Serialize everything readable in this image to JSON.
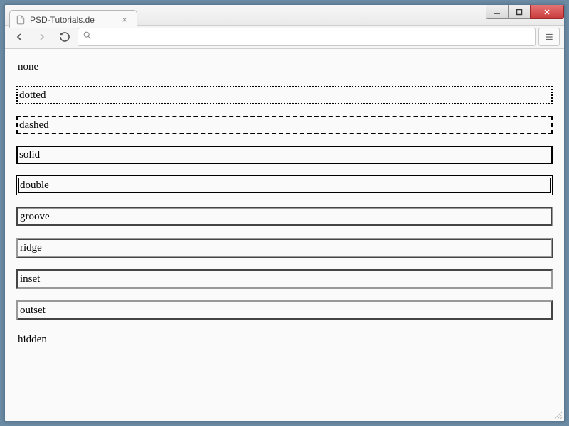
{
  "window": {
    "controls": {
      "min": "–",
      "max": "▢",
      "close": "✕"
    }
  },
  "tab": {
    "title": "PSD-Tutorials.de",
    "close_glyph": "×"
  },
  "toolbar": {
    "omnibox_value": "",
    "omnibox_placeholder": ""
  },
  "content": {
    "items": [
      {
        "label": "none",
        "class": "b-none"
      },
      {
        "label": "dotted",
        "class": "b-dotted"
      },
      {
        "label": "dashed",
        "class": "b-dashed"
      },
      {
        "label": "solid",
        "class": "b-solid"
      },
      {
        "label": "double",
        "class": "b-double"
      },
      {
        "label": "groove",
        "class": "b-groove"
      },
      {
        "label": "ridge",
        "class": "b-ridge"
      },
      {
        "label": "inset",
        "class": "b-inset"
      },
      {
        "label": "outset",
        "class": "b-outset"
      },
      {
        "label": "hidden",
        "class": "b-hidden"
      }
    ]
  }
}
